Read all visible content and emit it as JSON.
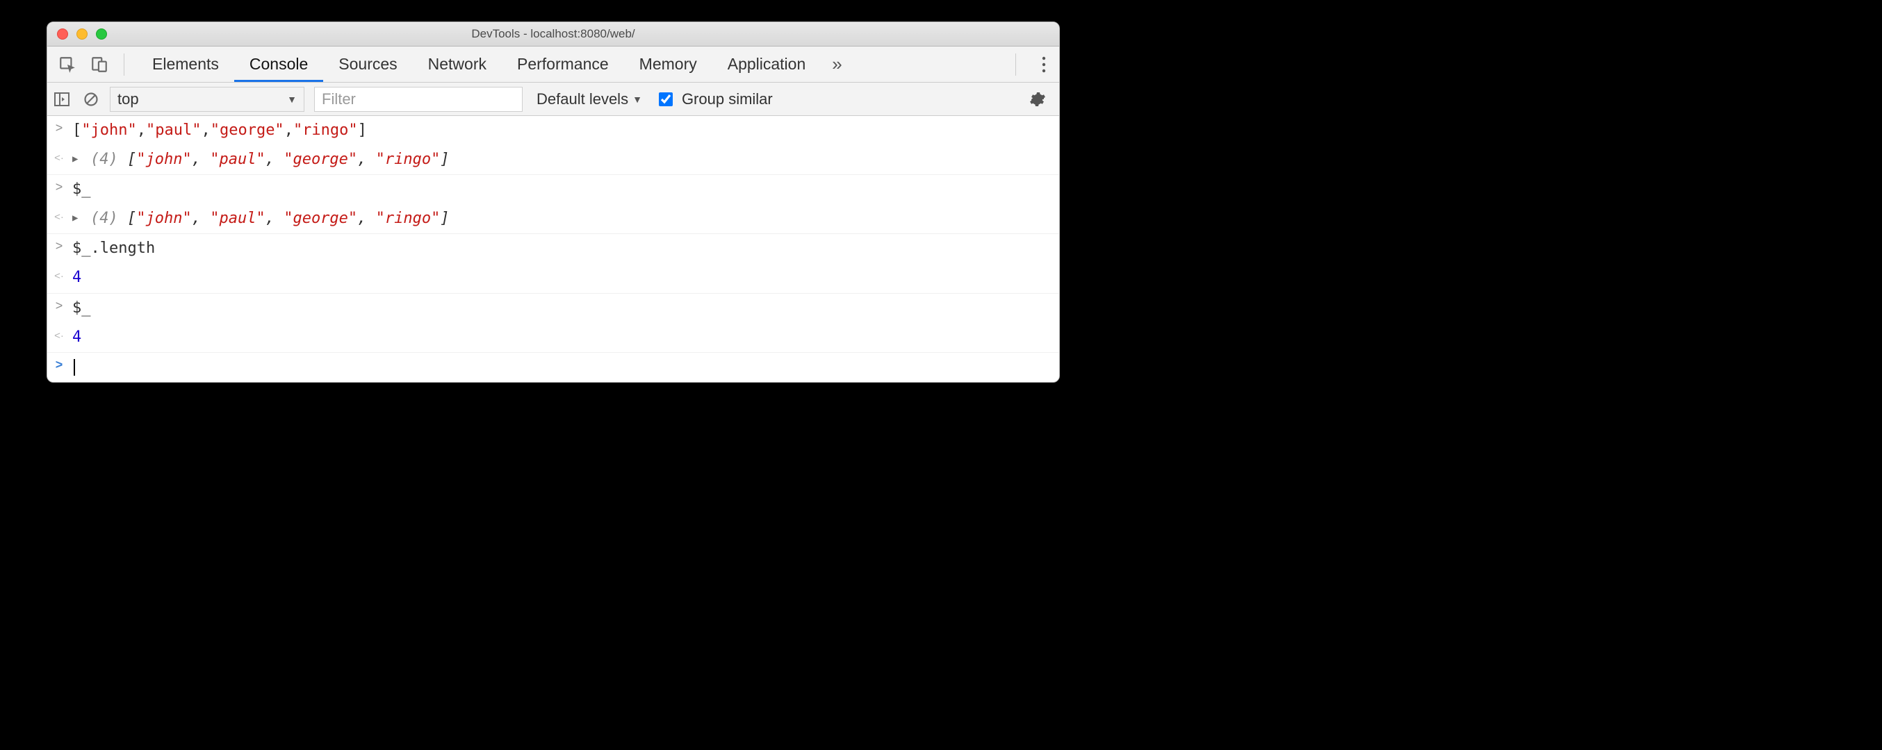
{
  "window": {
    "title": "DevTools - localhost:8080/web/"
  },
  "tabs": {
    "items": [
      "Elements",
      "Console",
      "Sources",
      "Network",
      "Performance",
      "Memory",
      "Application"
    ],
    "active_index": 1
  },
  "toolbar": {
    "context": "top",
    "filter_placeholder": "Filter",
    "levels_label": "Default levels",
    "group_label": "Group similar",
    "group_checked": true
  },
  "lines": [
    {
      "kind": "input",
      "tokens": [
        {
          "t": "[",
          "c": "punc"
        },
        {
          "t": "\"john\"",
          "c": "str"
        },
        {
          "t": ",",
          "c": "punc"
        },
        {
          "t": "\"paul\"",
          "c": "str"
        },
        {
          "t": ",",
          "c": "punc"
        },
        {
          "t": "\"george\"",
          "c": "str"
        },
        {
          "t": ",",
          "c": "punc"
        },
        {
          "t": "\"ringo\"",
          "c": "str"
        },
        {
          "t": "]",
          "c": "punc"
        }
      ]
    },
    {
      "kind": "output",
      "expand": true,
      "italic": true,
      "tokens": [
        {
          "t": "(4) ",
          "c": "meta"
        },
        {
          "t": "[",
          "c": "punc"
        },
        {
          "t": "\"john\"",
          "c": "str"
        },
        {
          "t": ", ",
          "c": "punc"
        },
        {
          "t": "\"paul\"",
          "c": "str"
        },
        {
          "t": ", ",
          "c": "punc"
        },
        {
          "t": "\"george\"",
          "c": "str"
        },
        {
          "t": ", ",
          "c": "punc"
        },
        {
          "t": "\"ringo\"",
          "c": "str"
        },
        {
          "t": "]",
          "c": "punc"
        }
      ]
    },
    {
      "kind": "input",
      "tokens": [
        {
          "t": "$_",
          "c": "punc"
        }
      ]
    },
    {
      "kind": "output",
      "expand": true,
      "italic": true,
      "tokens": [
        {
          "t": "(4) ",
          "c": "meta"
        },
        {
          "t": "[",
          "c": "punc"
        },
        {
          "t": "\"john\"",
          "c": "str"
        },
        {
          "t": ", ",
          "c": "punc"
        },
        {
          "t": "\"paul\"",
          "c": "str"
        },
        {
          "t": ", ",
          "c": "punc"
        },
        {
          "t": "\"george\"",
          "c": "str"
        },
        {
          "t": ", ",
          "c": "punc"
        },
        {
          "t": "\"ringo\"",
          "c": "str"
        },
        {
          "t": "]",
          "c": "punc"
        }
      ]
    },
    {
      "kind": "input",
      "tokens": [
        {
          "t": "$_.length",
          "c": "punc"
        }
      ]
    },
    {
      "kind": "output",
      "tokens": [
        {
          "t": "4",
          "c": "num"
        }
      ]
    },
    {
      "kind": "input",
      "tokens": [
        {
          "t": "$_",
          "c": "punc"
        }
      ]
    },
    {
      "kind": "output",
      "tokens": [
        {
          "t": "4",
          "c": "num"
        }
      ]
    },
    {
      "kind": "prompt"
    }
  ]
}
